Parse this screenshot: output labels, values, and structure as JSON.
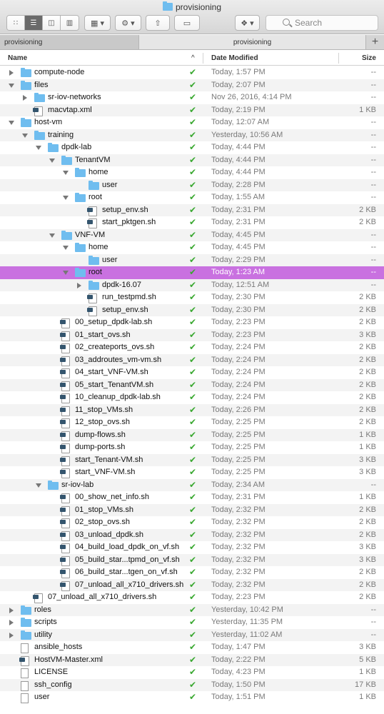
{
  "window": {
    "title": "provisioning"
  },
  "toolbar": {
    "view_icon_label": "∷",
    "view_list_label": "☰",
    "view_columns_label": "◫",
    "view_cover_label": "▥",
    "arrange_label": "▦ ▾",
    "action_label": "⚙ ▾",
    "share_label": "⇧",
    "tag_label": "▭",
    "dropbox_label": "❖ ▾",
    "search_placeholder": "Search"
  },
  "tabs": [
    {
      "label": "provisioning"
    },
    {
      "label": "provisioning"
    }
  ],
  "tab_add_label": "+",
  "columns": {
    "name": "Name",
    "sort_indicator": "^",
    "date": "Date Modified",
    "size": "Size"
  },
  "status_check": "✔",
  "rows": [
    {
      "name": "compute-node",
      "date": "Today, 1:57 PM",
      "size": "--"
    },
    {
      "name": "files",
      "date": "Today, 2:07 PM",
      "size": "--"
    },
    {
      "name": "sr-iov-networks",
      "date": "Nov 26, 2016, 4:14 PM",
      "size": "--"
    },
    {
      "name": "macvtap.xml",
      "date": "Today, 2:19 PM",
      "size": "1 KB"
    },
    {
      "name": "host-vm",
      "date": "Today, 12:07 AM",
      "size": "--"
    },
    {
      "name": "training",
      "date": "Yesterday, 10:56 AM",
      "size": "--"
    },
    {
      "name": "dpdk-lab",
      "date": "Today, 4:44 PM",
      "size": "--"
    },
    {
      "name": "TenantVM",
      "date": "Today, 4:44 PM",
      "size": "--"
    },
    {
      "name": "home",
      "date": "Today, 4:44 PM",
      "size": "--"
    },
    {
      "name": "user",
      "date": "Today, 2:28 PM",
      "size": "--"
    },
    {
      "name": "root",
      "date": "Today, 1:55 AM",
      "size": "--"
    },
    {
      "name": "setup_env.sh",
      "date": "Today, 2:31 PM",
      "size": "2 KB"
    },
    {
      "name": "start_pktgen.sh",
      "date": "Today, 2:31 PM",
      "size": "2 KB"
    },
    {
      "name": "VNF-VM",
      "date": "Today, 4:45 PM",
      "size": "--"
    },
    {
      "name": "home",
      "date": "Today, 4:45 PM",
      "size": "--"
    },
    {
      "name": "user",
      "date": "Today, 2:29 PM",
      "size": "--"
    },
    {
      "name": "root",
      "date": "Today, 1:23 AM",
      "size": "--"
    },
    {
      "name": "dpdk-16.07",
      "date": "Today, 12:51 AM",
      "size": "--"
    },
    {
      "name": "run_testpmd.sh",
      "date": "Today, 2:30 PM",
      "size": "2 KB"
    },
    {
      "name": "setup_env.sh",
      "date": "Today, 2:30 PM",
      "size": "2 KB"
    },
    {
      "name": "00_setup_dpdk-lab.sh",
      "date": "Today, 2:23 PM",
      "size": "2 KB"
    },
    {
      "name": "01_start_ovs.sh",
      "date": "Today, 2:23 PM",
      "size": "3 KB"
    },
    {
      "name": "02_createports_ovs.sh",
      "date": "Today, 2:24 PM",
      "size": "2 KB"
    },
    {
      "name": "03_addroutes_vm-vm.sh",
      "date": "Today, 2:24 PM",
      "size": "2 KB"
    },
    {
      "name": "04_start_VNF-VM.sh",
      "date": "Today, 2:24 PM",
      "size": "2 KB"
    },
    {
      "name": "05_start_TenantVM.sh",
      "date": "Today, 2:24 PM",
      "size": "2 KB"
    },
    {
      "name": "10_cleanup_dpdk-lab.sh",
      "date": "Today, 2:24 PM",
      "size": "2 KB"
    },
    {
      "name": "11_stop_VMs.sh",
      "date": "Today, 2:26 PM",
      "size": "2 KB"
    },
    {
      "name": "12_stop_ovs.sh",
      "date": "Today, 2:25 PM",
      "size": "2 KB"
    },
    {
      "name": "dump-flows.sh",
      "date": "Today, 2:25 PM",
      "size": "1 KB"
    },
    {
      "name": "dump-ports.sh",
      "date": "Today, 2:25 PM",
      "size": "1 KB"
    },
    {
      "name": "start_Tenant-VM.sh",
      "date": "Today, 2:25 PM",
      "size": "3 KB"
    },
    {
      "name": "start_VNF-VM.sh",
      "date": "Today, 2:25 PM",
      "size": "3 KB"
    },
    {
      "name": "sr-iov-lab",
      "date": "Today, 2:34 AM",
      "size": "--"
    },
    {
      "name": "00_show_net_info.sh",
      "date": "Today, 2:31 PM",
      "size": "1 KB"
    },
    {
      "name": "01_stop_VMs.sh",
      "date": "Today, 2:32 PM",
      "size": "2 KB"
    },
    {
      "name": "02_stop_ovs.sh",
      "date": "Today, 2:32 PM",
      "size": "2 KB"
    },
    {
      "name": "03_unload_dpdk.sh",
      "date": "Today, 2:32 PM",
      "size": "2 KB"
    },
    {
      "name": "04_build_load_dpdk_on_vf.sh",
      "date": "Today, 2:32 PM",
      "size": "3 KB"
    },
    {
      "name": "05_build_star...tpmd_on_vf.sh",
      "date": "Today, 2:32 PM",
      "size": "3 KB"
    },
    {
      "name": "06_build_star...tgen_on_vf.sh",
      "date": "Today, 2:32 PM",
      "size": "2 KB"
    },
    {
      "name": "07_unload_all_x710_drivers.sh",
      "date": "Today, 2:32 PM",
      "size": "2 KB"
    },
    {
      "name": "07_unload_all_x710_drivers.sh",
      "date": "Today, 2:23 PM",
      "size": "2 KB"
    },
    {
      "name": "roles",
      "date": "Yesterday, 10:42 PM",
      "size": "--"
    },
    {
      "name": "scripts",
      "date": "Yesterday, 11:35 PM",
      "size": "--"
    },
    {
      "name": "utility",
      "date": "Yesterday, 11:02 AM",
      "size": "--"
    },
    {
      "name": "ansible_hosts",
      "date": "Today, 1:47 PM",
      "size": "3 KB"
    },
    {
      "name": "HostVM-Master.xml",
      "date": "Today, 2:22 PM",
      "size": "5 KB"
    },
    {
      "name": "LICENSE",
      "date": "Today, 4:23 PM",
      "size": "1 KB"
    },
    {
      "name": "ssh_config",
      "date": "Today, 1:50 PM",
      "size": "17 KB"
    },
    {
      "name": "user",
      "date": "Today, 1:51 PM",
      "size": "1 KB"
    }
  ]
}
